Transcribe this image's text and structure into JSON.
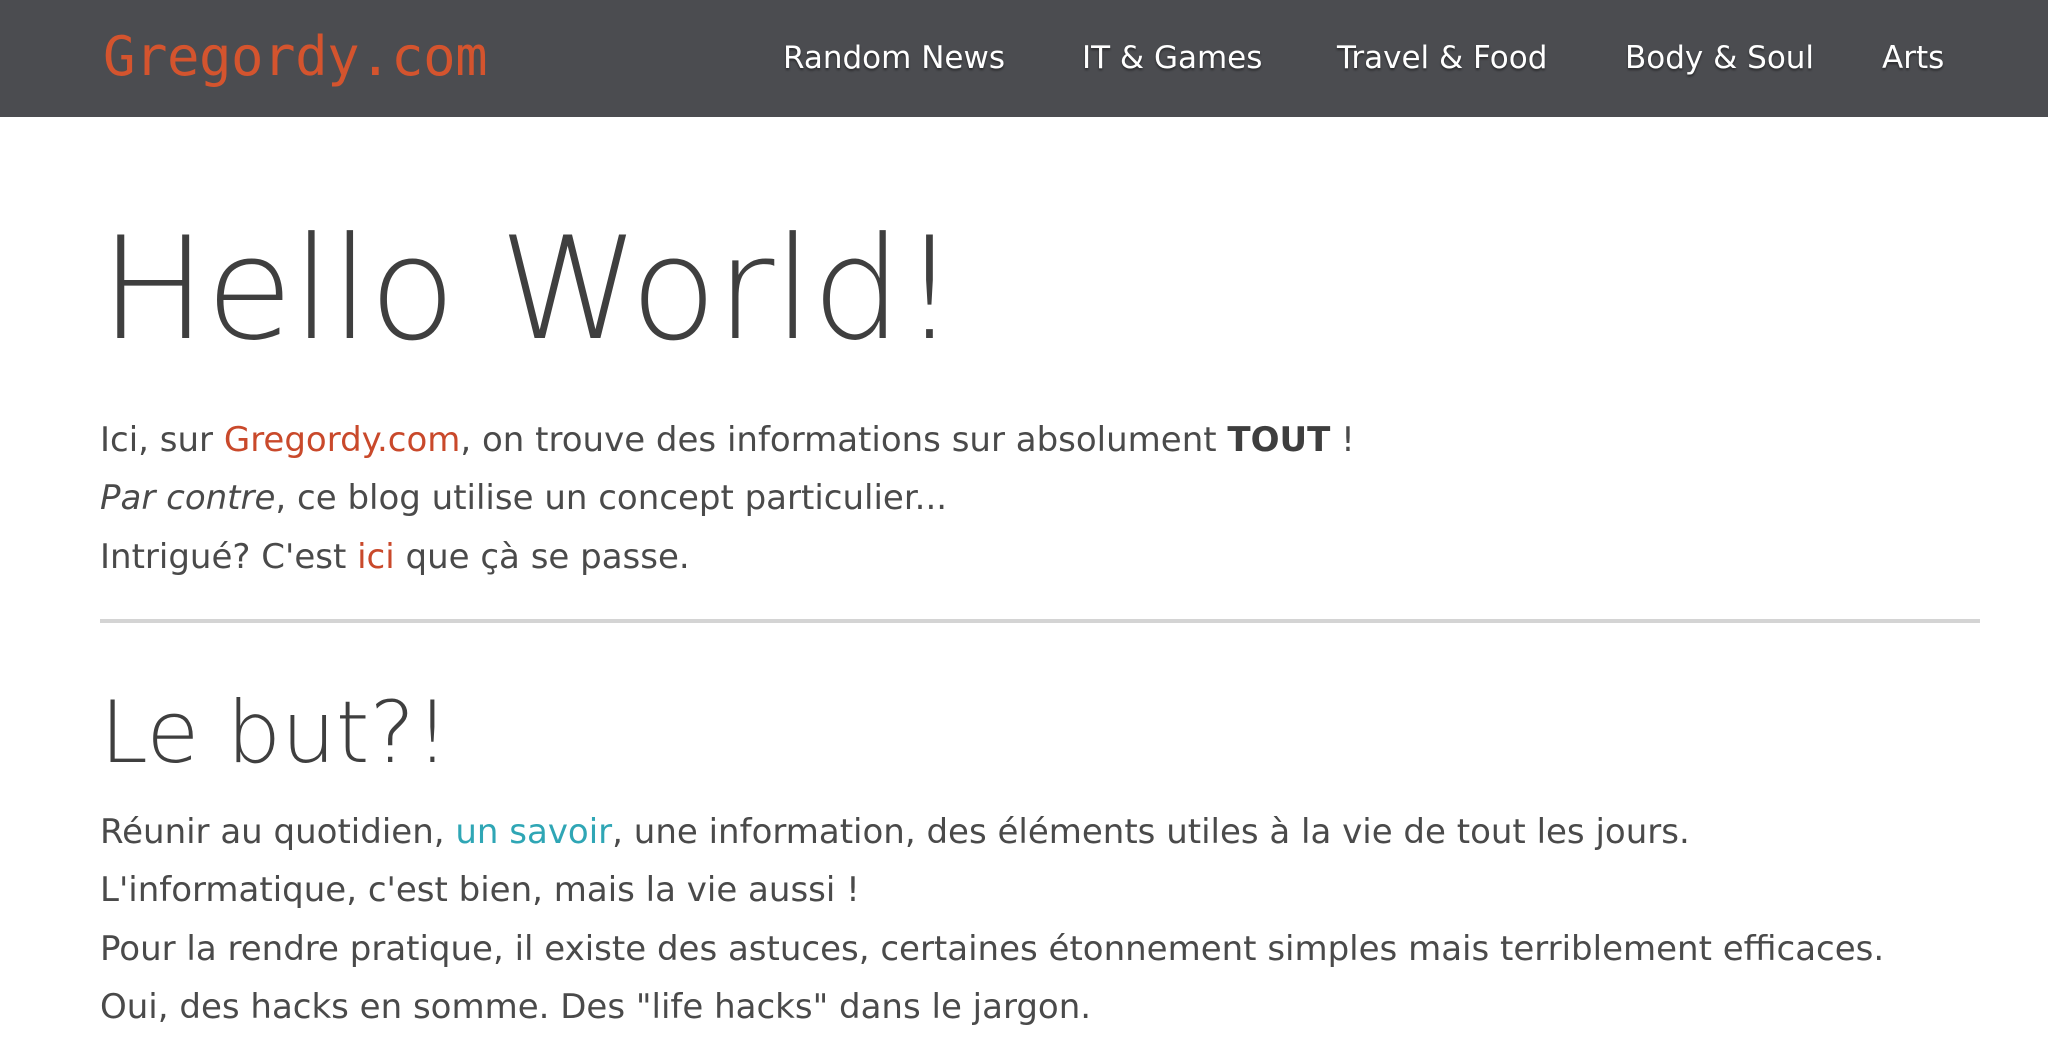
{
  "header": {
    "logo": "Gregordy.com",
    "nav": [
      "Random News",
      "IT & Games",
      "Travel & Food",
      "Body & Soul",
      "Arts"
    ]
  },
  "intro": {
    "title": "Hello World!",
    "line1": {
      "pre": "Ici, sur ",
      "link": "Gregordy.com",
      "mid": ", on trouve des informations sur absolument ",
      "bold": "TOUT",
      "post": " !"
    },
    "line2": {
      "italic": "Par contre",
      "rest": ", ce blog utilise un concept particulier..."
    },
    "line3": {
      "pre": "Intrigué? C'est ",
      "link": "ici",
      "post": " que çà se passe."
    }
  },
  "section": {
    "title": "Le but?!",
    "line1": {
      "pre": "Réunir au quotidien, ",
      "link": "un savoir",
      "post": ", une information, des éléments utiles à la vie de tout les jours."
    },
    "line2": "L'informatique, c'est bien, mais la vie aussi !",
    "line3": "Pour la rendre pratique, il existe des astuces, certaines étonnement simples mais terriblement efficaces.",
    "line4": "Oui, des hacks en somme. Des \"life hacks\" dans le jargon."
  },
  "colors": {
    "header_bg": "#4b4c50",
    "logo": "#d4542e",
    "accent_link": "#c9492b",
    "teal_link": "#2fa6b5",
    "divider": "#d4d4d4"
  }
}
